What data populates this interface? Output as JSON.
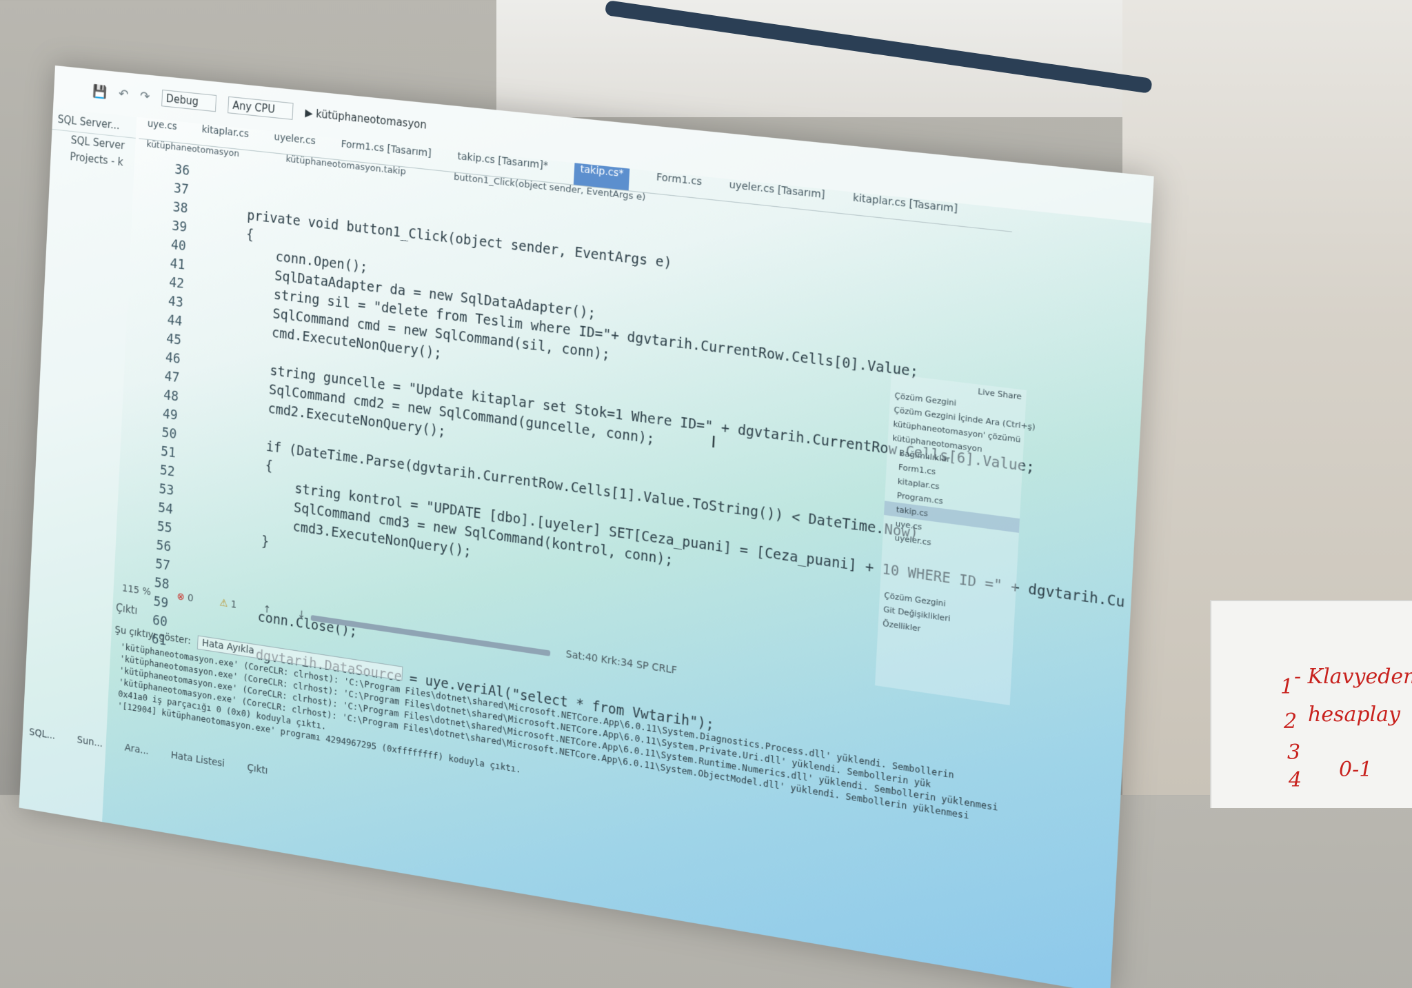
{
  "toolbar": {
    "config": "Debug",
    "platform": "Any CPU",
    "run_target": "kütüphaneotomasyon"
  },
  "left_panel": {
    "title": "SQL Server...",
    "items": [
      "SQL Server",
      "Projects - k"
    ]
  },
  "tabs": [
    {
      "label": "uye.cs"
    },
    {
      "label": "kitaplar.cs"
    },
    {
      "label": "uyeler.cs"
    },
    {
      "label": "Form1.cs [Tasarım]"
    },
    {
      "label": "takip.cs [Tasarım]*"
    },
    {
      "label": "takip.cs*"
    },
    {
      "label": "Form1.cs"
    },
    {
      "label": "uyeler.cs [Tasarım]"
    },
    {
      "label": "kitaplar.cs [Tasarım]"
    }
  ],
  "nav": {
    "project": "kütüphaneotomasyon",
    "class": "kütüphaneotomasyon.takip",
    "member": "button1_Click(object sender, EventArgs e)"
  },
  "code_lines": [
    {
      "n": "36",
      "t": ""
    },
    {
      "n": "37",
      "t": ""
    },
    {
      "n": "38",
      "t": "private void button1_Click(object sender, EventArgs e)"
    },
    {
      "n": "39",
      "t": "{"
    },
    {
      "n": "40",
      "t": "    conn.Open();"
    },
    {
      "n": "41",
      "t": "    SqlDataAdapter da = new SqlDataAdapter();"
    },
    {
      "n": "42",
      "t": "    string sil = \"delete from Teslim where ID=\"+ dgvtarih.CurrentRow.Cells[0].Value;"
    },
    {
      "n": "43",
      "t": "    SqlCommand cmd = new SqlCommand(sil, conn);"
    },
    {
      "n": "44",
      "t": "    cmd.ExecuteNonQuery();"
    },
    {
      "n": "45",
      "t": ""
    },
    {
      "n": "46",
      "t": "    string guncelle = \"Update kitaplar set Stok=1 Where ID=\" + dgvtarih.CurrentRow.Cells[6].Value;"
    },
    {
      "n": "47",
      "t": "    SqlCommand cmd2 = new SqlCommand(guncelle, conn);"
    },
    {
      "n": "48",
      "t": "    cmd2.ExecuteNonQuery();"
    },
    {
      "n": "49",
      "t": ""
    },
    {
      "n": "50",
      "t": "    if (DateTime.Parse(dgvtarih.CurrentRow.Cells[1].Value.ToString()) < DateTime.Now)"
    },
    {
      "n": "51",
      "t": "    {"
    },
    {
      "n": "52",
      "t": "        string kontrol = \"UPDATE [dbo].[uyeler] SET[Ceza_puani] = [Ceza_puani] + 10 WHERE ID =\" + dgvtarih.Cu"
    },
    {
      "n": "53",
      "t": "        SqlCommand cmd3 = new SqlCommand(kontrol, conn);"
    },
    {
      "n": "54",
      "t": "        cmd3.ExecuteNonQuery();"
    },
    {
      "n": "55",
      "t": "    }"
    },
    {
      "n": "56",
      "t": ""
    },
    {
      "n": "57",
      "t": ""
    },
    {
      "n": "58",
      "t": ""
    },
    {
      "n": "59",
      "t": "    conn.Close();"
    },
    {
      "n": "60",
      "t": ""
    },
    {
      "n": "61",
      "t": "    dgvtarih.DataSource = uye.veriAl(\"select * from Vwtarih\");"
    }
  ],
  "status": {
    "zoom": "115 %",
    "errors": "0",
    "warnings": "1",
    "position": "Sat:40   Krk:34   SP   CRLF"
  },
  "output": {
    "title": "Çıktı",
    "show_label": "Şu çıktıyı göster:",
    "source": "Hata Ayıkla",
    "lines": [
      "'kütüphaneotomasyon.exe' (CoreCLR: clrhost): 'C:\\Program Files\\dotnet\\shared\\Microsoft.NETCore.App\\6.0.11\\System.Diagnostics.Process.dll' yüklendi. Sembollerin",
      "'kütüphaneotomasyon.exe' (CoreCLR: clrhost): 'C:\\Program Files\\dotnet\\shared\\Microsoft.NETCore.App\\6.0.11\\System.Private.Uri.dll' yüklendi. Sembollerin yük",
      "'kütüphaneotomasyon.exe' (CoreCLR: clrhost): 'C:\\Program Files\\dotnet\\shared\\Microsoft.NETCore.App\\6.0.11\\System.Runtime.Numerics.dll' yüklendi. Sembollerin yüklenmesi",
      "'kütüphaneotomasyon.exe' (CoreCLR: clrhost): 'C:\\Program Files\\dotnet\\shared\\Microsoft.NETCore.App\\6.0.11\\System.ObjectModel.dll' yüklendi. Sembollerin yüklenmesi",
      "0x41a0 iş parçacığı 0 (0x0) koduyla çıktı.",
      "'[12904] kütüphaneotomasyon.exe' programı 4294967295 (0xffffffff) koduyla çıktı."
    ]
  },
  "bottom_tabs": [
    "SQL...",
    "Sun...",
    "Ara...",
    "Hata Listesi",
    "Çıktı"
  ],
  "solution": {
    "title": "Çözüm Gezgini",
    "search": "Çözüm Gezgini İçinde Ara (Ctrl+ş)",
    "items": [
      "kütüphaneotomasyon' çözümü",
      "kütüphaneotomasyon",
      "Bağımlılıklar",
      "Form1.cs",
      "kitaplar.cs",
      "Program.cs",
      "takip.cs",
      "uye.cs",
      "uyeler.cs"
    ],
    "footer_tabs": [
      "Çözüm Gezgini",
      "Git Değişiklikleri"
    ],
    "properties": "Özellikler",
    "live_share": "Live Share"
  },
  "whiteboard": [
    "- Klavyeden",
    "hesaplay",
    "1",
    "2",
    "3",
    "4",
    "0-1"
  ]
}
